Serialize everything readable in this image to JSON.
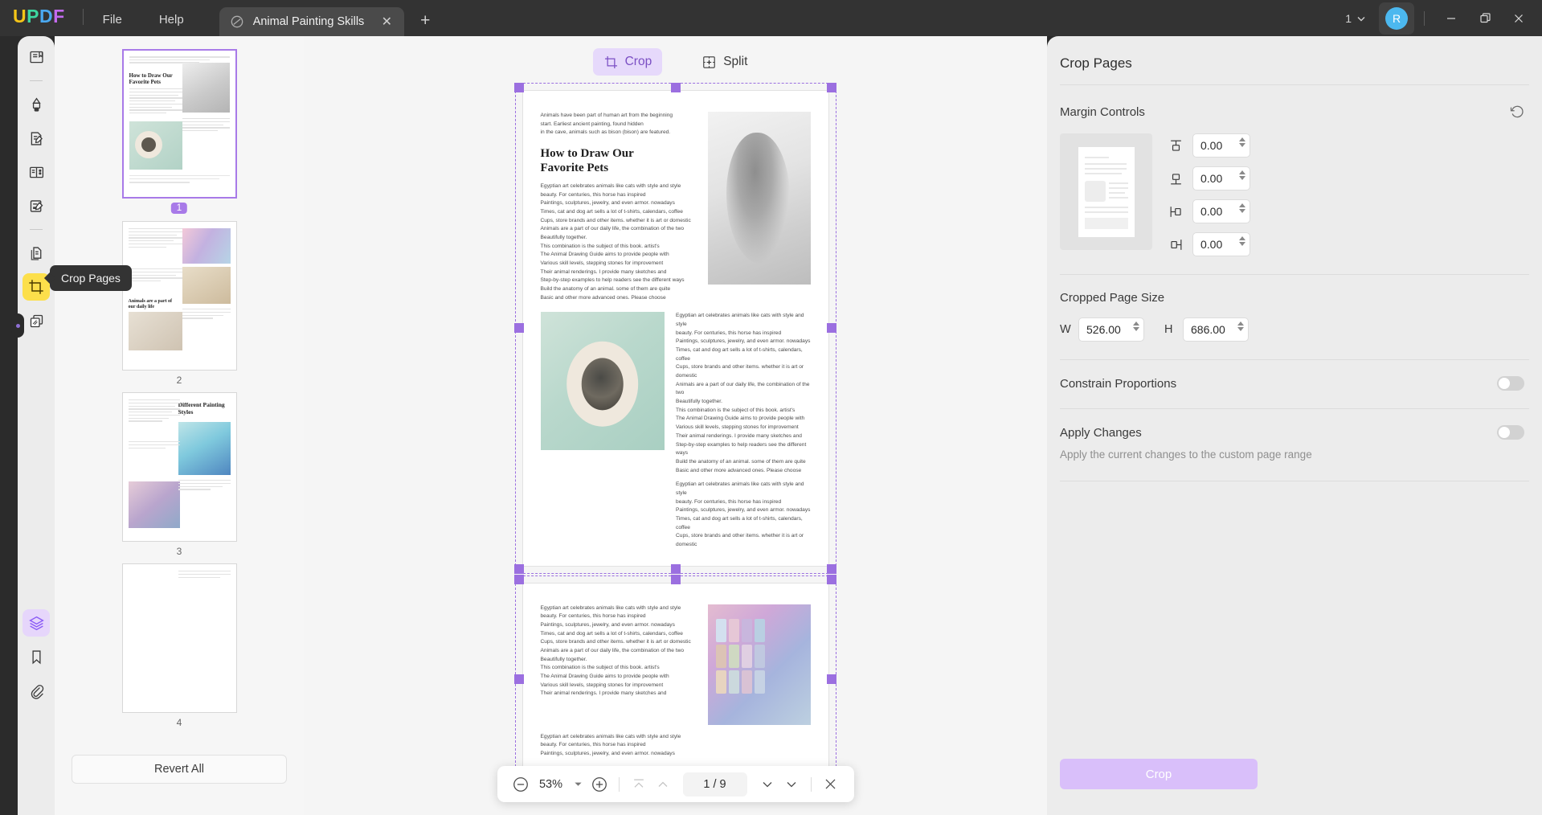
{
  "titlebar": {
    "logo_text": "UPDF",
    "menus": [
      {
        "label": "File",
        "name": "menu-file"
      },
      {
        "label": "Help",
        "name": "menu-help"
      }
    ],
    "document_tab": {
      "title": "Animal Painting Skills",
      "close_label": "✕",
      "icon": "document-icon"
    },
    "new_tab_label": "+",
    "window_count": "1",
    "avatar_initial": "R",
    "minimize_label": "—",
    "maximize_label": "❐",
    "close_label": "✕"
  },
  "left_rail": {
    "tooltip_text": "Crop Pages",
    "items": [
      {
        "name": "reader-mode-icon",
        "label": "Reader"
      },
      {
        "name": "annotate-highlighter-icon",
        "label": "Comment"
      },
      {
        "name": "edit-pdf-icon",
        "label": "Edit PDF"
      },
      {
        "name": "page-organize-icon",
        "label": "Organize Pages"
      },
      {
        "name": "form-edit-icon",
        "label": "Prepare Form"
      },
      {
        "name": "convert-pdf-icon",
        "label": "Convert PDF"
      },
      {
        "name": "crop-pages-icon",
        "label": "Crop Pages"
      },
      {
        "name": "protect-redact-icon",
        "label": "Protect"
      }
    ],
    "bottom_items": [
      {
        "name": "layers-icon",
        "label": "Layers"
      },
      {
        "name": "bookmark-icon",
        "label": "Bookmarks"
      },
      {
        "name": "attachment-icon",
        "label": "Attachments"
      }
    ]
  },
  "thumbnails": {
    "revert_label": "Revert All",
    "pages": [
      {
        "number": "1",
        "selected": true
      },
      {
        "number": "2",
        "selected": false
      },
      {
        "number": "3",
        "selected": false
      },
      {
        "number": "4",
        "selected": false
      }
    ]
  },
  "viewer": {
    "tabs": [
      {
        "label": "Crop",
        "icon": "crop-icon",
        "active": true
      },
      {
        "label": "Split",
        "icon": "split-icon",
        "active": false
      }
    ],
    "pages": [
      {
        "intro": "Animals have been part of human art from the beginning\nstart. Earliest ancient painting, found hidden\nin the cave, animals such as bison (bison) are featured.",
        "heading": "How to Draw Our\nFavorite Pets",
        "body": "Egyptian art celebrates animals like cats with style and style\nbeauty. For centuries, this horse has inspired\nPaintings, sculptures, jewelry, and even armor. nowadays\nTimes, cat and dog art sells a lot of t-shirts, calendars, coffee\nCups, store brands and other items. whether it is art or domestic\nAnimals are a part of our daily life, the combination of the two\nBeautifully together.\nThis combination is the subject of this book. artist's\nThe Animal Drawing Guide aims to provide people with\nVarious skill levels, stepping stones for improvement\nTheir animal renderings. I provide many sketches and\nStep-by-step examples to help readers see the different ways\nBuild the anatomy of an animal. some of them are quite\nBasic and other more advanced ones. Please choose",
        "body2": "Egyptian art celebrates animals like cats with style and style\nbeauty. For centuries, this horse has inspired\nPaintings, sculptures, jewelry, and even armor. nowadays\nTimes, cat and dog art sells a lot of t-shirts, calendars, coffee\nCups, store brands and other items. whether it is art or domestic\nAnimals are a part of our daily life, the combination of the two\nBeautifully together.\nThis combination is the subject of this book. artist's\nThe Animal Drawing Guide aims to provide people with\nVarious skill levels, stepping stones for improvement\nTheir animal renderings. I provide many sketches and\nStep-by-step examples to help readers see the different ways\nBuild the anatomy of an animal. some of them are quite\nBasic and other more advanced ones. Please choose",
        "body3": "Egyptian art celebrates animals like cats with style and style\nbeauty. For centuries, this horse has inspired\nPaintings, sculptures, jewelry, and even armor. nowadays\nTimes, cat and dog art sells a lot of t-shirts, calendars, coffee\nCups, store brands and other items. whether it is art or domestic"
      },
      {
        "body": "Egyptian art celebrates animals like cats with style and style\nbeauty. For centuries, this horse has inspired\nPaintings, sculptures, jewelry, and even armor. nowadays\nTimes, cat and dog art sells a lot of t-shirts, calendars, coffee\nCups, store brands and other items. whether it is art or domestic\nAnimals are a part of our daily life, the combination of the two\nBeautifully together.\nThis combination is the subject of this book. artist's\nThe Animal Drawing Guide aims to provide people with\nVarious skill levels, stepping stones for improvement\nTheir animal renderings. I provide many sketches and",
        "body2": "Egyptian art celebrates animals like cats with style and style\nbeauty. For centuries, this horse has inspired\nPaintings, sculptures, jewelry, and even armor. nowadays"
      }
    ]
  },
  "bottom_toolbar": {
    "zoom_out_label": "−",
    "zoom_value": "53%",
    "zoom_in_label": "+",
    "page_indicator": "1 / 9",
    "first_page_name": "first-page-icon",
    "prev_page_name": "previous-page-icon",
    "next_page_name": "next-page-icon",
    "last_page_name": "last-page-icon",
    "close_label": "✕"
  },
  "right_panel": {
    "title": "Crop Pages",
    "margin_section": {
      "label": "Margin Controls",
      "reset_name": "reset-icon",
      "fields": [
        {
          "name": "margin-top-input",
          "icon": "margin-top-icon",
          "value": "0.00"
        },
        {
          "name": "margin-bottom-input",
          "icon": "margin-bottom-icon",
          "value": "0.00"
        },
        {
          "name": "margin-left-input",
          "icon": "margin-left-icon",
          "value": "0.00"
        },
        {
          "name": "margin-right-input",
          "icon": "margin-right-icon",
          "value": "0.00"
        }
      ]
    },
    "page_size": {
      "label": "Cropped Page Size",
      "width_label": "W",
      "width_value": "526.00",
      "height_label": "H",
      "height_value": "686.00"
    },
    "constrain": {
      "label": "Constrain Proportions",
      "enabled": false
    },
    "apply_changes": {
      "label": "Apply Changes",
      "enabled": false,
      "helper": "Apply the current changes to the custom page range"
    },
    "crop_button_label": "Crop"
  },
  "colors": {
    "titlebar_bg": "#333333",
    "accent_purple": "#a87ae8",
    "crop_highlight": "#fcdf4b",
    "crop_button": "#d9bffa",
    "panel_bg": "#ececec",
    "viewer_bg": "#f5f5f5"
  }
}
